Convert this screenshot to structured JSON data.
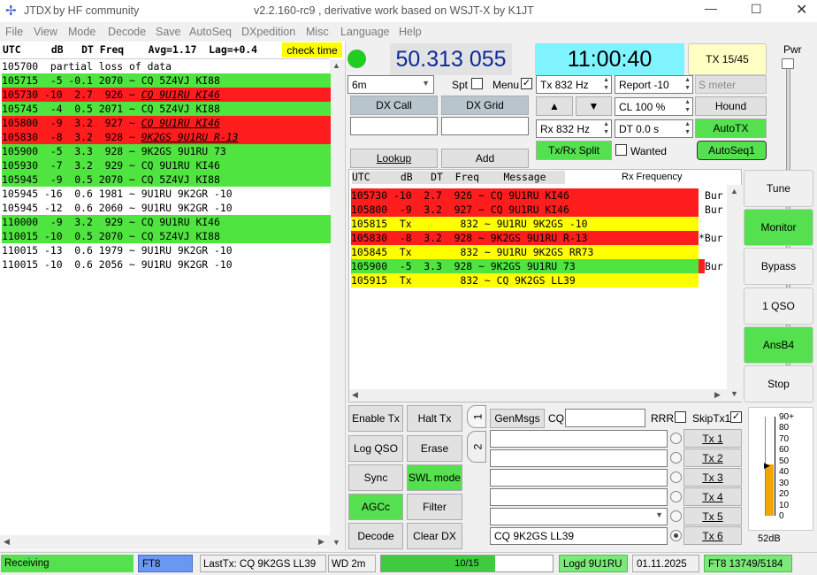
{
  "window": {
    "app_name": "JTDX",
    "by": "by HF community",
    "version_text": "v2.2.160-rc9 , derivative work based on WSJT-X by K1JT"
  },
  "menu": [
    "File",
    "View",
    "Mode",
    "Decode",
    "Save",
    "AutoSeq",
    "DXpedition",
    "Misc",
    "Language",
    "Help"
  ],
  "band_activity": {
    "header": "UTC     dB   DT Freq    Avg=1.17  Lag=+0.4",
    "check_time": "check time",
    "rows": [
      {
        "text": "105700  partial loss of data",
        "bg": "none",
        "italic": false
      },
      {
        "text": "105715  -5 -0.1 2070 ~ CQ 5Z4VJ KI88",
        "bg": "green",
        "italic": false
      },
      {
        "text": "105730 -10  2.7  926 ~ ",
        "rest": "CQ 9U1RU KI46",
        "bg": "red",
        "italic": true
      },
      {
        "text": "105745  -4  0.5 2071 ~ CQ 5Z4VJ KI88",
        "bg": "green",
        "italic": false
      },
      {
        "text": "105800  -9  3.2  927 ~ ",
        "rest": "CQ 9U1RU KI46",
        "bg": "red",
        "italic": true
      },
      {
        "text": "105830  -8  3.2  928 ~ ",
        "rest": "9K2GS 9U1RU R-13",
        "bg": "red",
        "italic": true
      },
      {
        "text": "105900  -5  3.3  928 ~ 9K2GS 9U1RU 73",
        "bg": "green",
        "italic": false
      },
      {
        "text": "105930  -7  3.2  929 ~ CQ 9U1RU KI46",
        "bg": "green",
        "italic": false
      },
      {
        "text": "105945  -9  0.5 2070 ~ CQ 5Z4VJ KI88",
        "bg": "green",
        "italic": false
      },
      {
        "text": "105945 -16  0.6 1981 ~ 9U1RU 9K2GR -10",
        "bg": "none",
        "italic": false
      },
      {
        "text": "105945 -12  0.6 2060 ~ 9U1RU 9K2GR -10",
        "bg": "none",
        "italic": false
      },
      {
        "text": "110000  -9  3.2  929 ~ CQ 9U1RU KI46",
        "bg": "green",
        "italic": false
      },
      {
        "text": "110015 -10  0.5 2070 ~ CQ 5Z4VJ KI88",
        "bg": "green",
        "italic": false
      },
      {
        "text": "110015 -13  0.6 1979 ~ 9U1RU 9K2GR -10",
        "bg": "none",
        "italic": false
      },
      {
        "text": "110015 -10  0.6 2056 ~ 9U1RU 9K2GR -10",
        "bg": "none",
        "italic": false
      }
    ]
  },
  "top": {
    "frequency": "50.313 055",
    "time": "11:00:40",
    "tx_button": "TX 15/45",
    "band": "6m",
    "spt": "Spt",
    "menu_label": "Menu",
    "tx_hz": "Tx  832  Hz",
    "report": "Report -10",
    "smeter": "S meter",
    "dx_call": "DX Call",
    "dx_grid": "DX Grid",
    "cl": "CL  100 %",
    "hound": "Hound",
    "rx_hz": "Rx  832  Hz",
    "dt": "DT 0.0 s",
    "autotx": "AutoTX",
    "txrx_split": "Tx/Rx Split",
    "wanted": "Wanted",
    "autoseq": "AutoSeq1",
    "lookup": "Lookup",
    "add": "Add",
    "pwr": "Pwr"
  },
  "rx_frequency": {
    "header": "UTC     dB   DT  Freq    Message",
    "title": "Rx Frequency",
    "rows": [
      {
        "text": "105730 -10  2.7  926 ~ CQ 9U1RU KI46",
        "bg": "red",
        "extra": "Bur"
      },
      {
        "text": "105800  -9  3.2  927 ~ CQ 9U1RU KI46",
        "bg": "red",
        "extra": "Bur"
      },
      {
        "text": "105815  Tx        832 ~ 9U1RU 9K2GS -10",
        "bg": "yellow",
        "extra": ""
      },
      {
        "text": "105830  -8  3.2  928 ~ 9K2GS 9U1RU R-13",
        "bg": "red",
        "extra": "*Bur"
      },
      {
        "text": "105845  Tx        832 ~ 9U1RU 9K2GS RR73",
        "bg": "yellow",
        "extra": ""
      },
      {
        "text": "105900  -5  3.3  928 ~ 9K2GS 9U1RU 73",
        "bg": "green",
        "extra": "Bur"
      },
      {
        "text": "105915  Tx        832 ~ CQ 9K2GS LL39",
        "bg": "yellow",
        "extra": ""
      }
    ]
  },
  "right_buttons": [
    "Tune",
    "Monitor",
    "Bypass",
    "1 QSO",
    "AnsB4",
    "Stop"
  ],
  "controls": {
    "enable_tx": "Enable Tx",
    "halt_tx": "Halt Tx",
    "log_qso": "Log QSO",
    "erase": "Erase",
    "sync": "Sync",
    "swl_mode": "SWL mode",
    "agcc": "AGCc",
    "filter": "Filter",
    "decode": "Decode",
    "clear_dx": "Clear DX",
    "tab1": "1",
    "tab2": "2",
    "genmsgs": "GenMsgs",
    "cq": "CQ",
    "rrr": "RRR",
    "skiptx1": "SkipTx1",
    "tx_labels": [
      "Tx 1",
      "Tx 2",
      "Tx 3",
      "Tx 4",
      "Tx 5",
      "Tx 6"
    ],
    "tx6_msg": "CQ 9K2GS LL39"
  },
  "meter": {
    "scale": [
      "90+",
      "80",
      "70",
      "60",
      "50",
      "40",
      "30",
      "20",
      "10",
      "0"
    ],
    "value": "52dB",
    "level_fraction": 0.52
  },
  "status": {
    "receiving": "Receiving",
    "mode": "FT8",
    "last_tx": "LastTx: CQ 9K2GS LL39",
    "wd": "WD 2m",
    "progress": "10/15",
    "progress_fraction": 0.667,
    "logd": "Logd 9U1RU",
    "date": "01.11.2025",
    "counts": "FT8  13749/5184"
  }
}
